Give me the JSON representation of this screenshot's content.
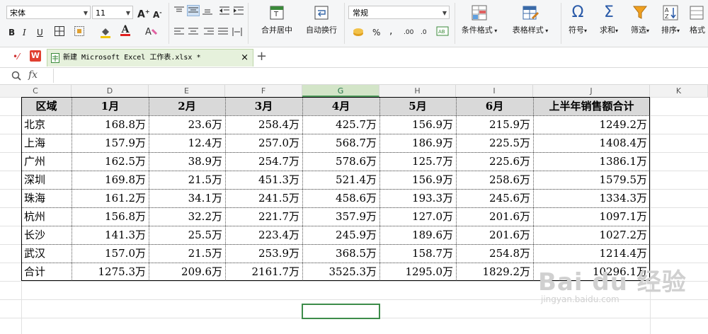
{
  "toolbar": {
    "font_name": "宋体",
    "font_size": "11",
    "number_format": "常规",
    "merge_center": "合并居中",
    "wrap_text": "自动换行",
    "cond_format": "条件格式",
    "table_style": "表格样式",
    "symbol": "符号",
    "sum": "求和",
    "filter": "筛选",
    "sort": "排序",
    "format": "格式",
    "percent": "%",
    "thousands": ","
  },
  "tab": {
    "file_name": "新建 Microsoft Excel 工作表.xlsx *",
    "close": "×",
    "add": "+"
  },
  "formula_bar": {
    "fx": "fx",
    "content": ""
  },
  "columns": [
    "C",
    "D",
    "E",
    "F",
    "G",
    "H",
    "I",
    "J",
    "K"
  ],
  "table": {
    "header": [
      "区域",
      "1月",
      "2月",
      "3月",
      "4月",
      "5月",
      "6月",
      "上半年销售额合计"
    ],
    "rows": [
      [
        "北京",
        "168.8万",
        "23.6万",
        "258.4万",
        "425.7万",
        "156.9万",
        "215.9万",
        "1249.2万"
      ],
      [
        "上海",
        "157.9万",
        "12.4万",
        "257.0万",
        "568.7万",
        "186.9万",
        "225.5万",
        "1408.4万"
      ],
      [
        "广州",
        "162.5万",
        "38.9万",
        "254.7万",
        "578.6万",
        "125.7万",
        "225.6万",
        "1386.1万"
      ],
      [
        "深圳",
        "169.8万",
        "21.5万",
        "451.3万",
        "521.4万",
        "156.9万",
        "258.6万",
        "1579.5万"
      ],
      [
        "珠海",
        "161.2万",
        "34.1万",
        "241.5万",
        "458.6万",
        "193.3万",
        "245.6万",
        "1334.3万"
      ],
      [
        "杭州",
        "156.8万",
        "32.2万",
        "221.7万",
        "357.9万",
        "127.0万",
        "201.6万",
        "1097.1万"
      ],
      [
        "长沙",
        "141.3万",
        "25.5万",
        "223.4万",
        "245.9万",
        "189.6万",
        "201.6万",
        "1027.2万"
      ],
      [
        "武汉",
        "157.0万",
        "21.5万",
        "253.9万",
        "368.5万",
        "158.7万",
        "254.8万",
        "1214.4万"
      ],
      [
        "合计",
        "1275.3万",
        "209.6万",
        "2161.7万",
        "3525.3万",
        "1295.0万",
        "1829.2万",
        "10296.1万"
      ]
    ]
  },
  "watermark": {
    "main": "Bai du 经验",
    "sub": "jingyan.baidu.com"
  },
  "colors": {
    "accent": "#217346",
    "header_fill": "#d9d9d9",
    "selection": "#3d8c4a"
  }
}
